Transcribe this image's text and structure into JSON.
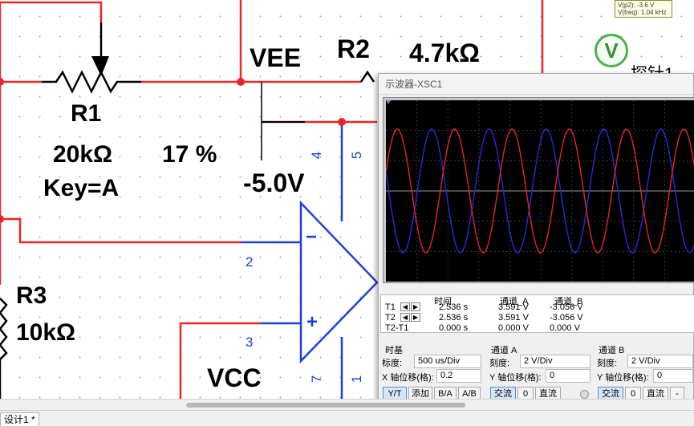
{
  "schematic": {
    "r1_name": "R1",
    "r1_value": "20kΩ",
    "r1_percent": "17 %",
    "r1_key": "Key=A",
    "vee_label": "VEE",
    "vee_voltage": "-5.0V",
    "r2_name": "R2",
    "r2_value": "4.7kΩ",
    "r3_name": "R3",
    "r3_value": "10kΩ",
    "vcc_label": "VCC",
    "pins": [
      "2",
      "3",
      "4",
      "5",
      "7",
      "1"
    ],
    "minus_sign": "−",
    "plus_sign": "+",
    "wire_color": "#e8262a",
    "pin_color": "#1f3fd6"
  },
  "probe": {
    "readout_line1": "V(p2): -3.6 V",
    "readout_line2": "V(freq): 1.04 kHz",
    "icon_letter": "V",
    "label": "探针1"
  },
  "scope": {
    "title": "示波器-XSC1",
    "readout": {
      "headers": [
        "时间",
        "通道_A",
        "通道_B"
      ],
      "rows": [
        {
          "label": "T1",
          "time": "2.536 s",
          "a": "3.591 V",
          "b": "-3.056 V"
        },
        {
          "label": "T2",
          "time": "2.536 s",
          "a": "3.591 V",
          "b": "-3.056 V"
        },
        {
          "label": "T2-T1",
          "time": "0.000 s",
          "a": "0.000 V",
          "b": "0.000 V"
        }
      ]
    },
    "timebase": {
      "title": "时基",
      "scale_label": "标度:",
      "scale_value": "500 us/Div",
      "xpos_label": "X 轴位移(格):",
      "xpos_value": "0.2",
      "buttons": [
        "Y/T",
        "添加",
        "B/A",
        "A/B"
      ]
    },
    "channel_a": {
      "title": "通道 A",
      "scale_label": "刻度:",
      "scale_value": "2  V/Div",
      "ypos_label": "Y 轴位移(格):",
      "ypos_value": "0",
      "buttons": [
        "交流",
        "0",
        "直流"
      ]
    },
    "channel_b": {
      "title": "通道 B",
      "scale_label": "刻度:",
      "scale_value": "2  V/Div",
      "ypos_label": "Y 轴位移(格):",
      "ypos_value": "0",
      "buttons": [
        "交流",
        "0",
        "直流",
        "-"
      ]
    },
    "trace_colors": {
      "a": "#e0262a",
      "b": "#2a2ad8"
    }
  },
  "tab": {
    "label": "设计1 *"
  }
}
